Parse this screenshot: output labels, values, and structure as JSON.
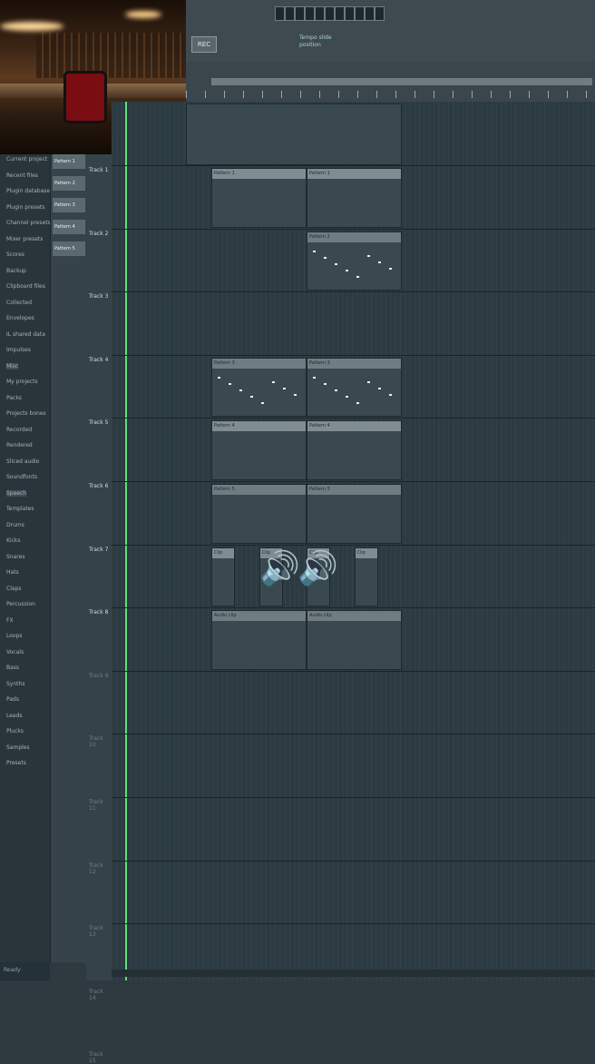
{
  "app": {
    "accent_color": "#5fe07a",
    "clip_header_color": "#7f8c91"
  },
  "toolbar": {
    "transport_label": "REC",
    "hint": "Tempo slide position",
    "icons": [
      "play-icon",
      "stop-icon",
      "record-icon",
      "pattern-icon",
      "song-icon",
      "snap-icon",
      "magnet-icon",
      "metronome-icon",
      "wait-icon",
      "countdown-icon",
      "loop-icon"
    ]
  },
  "browser": {
    "items": [
      "Current project",
      "Recent files",
      "Plugin database",
      "Plugin presets",
      "Channel presets",
      "Mixer presets",
      "Scores",
      "Backup",
      "Clipboard files",
      "Collected",
      "Envelopes",
      "IL shared data",
      "Impulses",
      "Misc",
      "My projects",
      "Packs",
      "Projects bones",
      "Recorded",
      "Rendered",
      "Sliced audio",
      "Soundfonts",
      "Speech",
      "Templates",
      "Drums",
      "Kicks",
      "Snares",
      "Hats",
      "Claps",
      "Percussion",
      "FX",
      "Loops",
      "Vocals",
      "Bass",
      "Synths",
      "Pads",
      "Leads",
      "Plucks",
      "Samples",
      "Presets"
    ]
  },
  "patterns": {
    "items": [
      "Pattern 1",
      "Pattern 2",
      "Pattern 3",
      "Pattern 4",
      "Pattern 5"
    ]
  },
  "tracks": {
    "labels": [
      "Track 1",
      "Track 2",
      "Track 3",
      "Track 4",
      "Track 5",
      "Track 6",
      "Track 7",
      "Track 8",
      "Track 9",
      "Track 10",
      "Track 11",
      "Track 12",
      "Track 13",
      "Track 14",
      "Track 15"
    ]
  },
  "clips": [
    {
      "row": 0,
      "start": 0,
      "len": 1,
      "title": "Pattern 1"
    },
    {
      "row": 0,
      "start": 1,
      "len": 1,
      "title": "Pattern 1"
    },
    {
      "row": 1,
      "start": 1,
      "len": 1,
      "title": "Pattern 2"
    },
    {
      "row": 3,
      "start": 0,
      "len": 1,
      "title": "Pattern 3"
    },
    {
      "row": 3,
      "start": 1,
      "len": 1,
      "title": "Pattern 3"
    },
    {
      "row": 4,
      "start": 0,
      "len": 1,
      "title": "Pattern 4"
    },
    {
      "row": 4,
      "start": 1,
      "len": 1,
      "title": "Pattern 4"
    },
    {
      "row": 5,
      "start": 0,
      "len": 1,
      "title": "Pattern 5"
    },
    {
      "row": 5,
      "start": 1,
      "len": 1,
      "title": "Pattern 5"
    },
    {
      "row": 6,
      "start": 0,
      "len": 0.25,
      "title": "Clip"
    },
    {
      "row": 6,
      "start": 0.5,
      "len": 0.25,
      "title": "Clip"
    },
    {
      "row": 6,
      "start": 1,
      "len": 0.25,
      "title": "Clip"
    },
    {
      "row": 6,
      "start": 1.5,
      "len": 0.25,
      "title": "Clip"
    },
    {
      "row": 7,
      "start": 0,
      "len": 1,
      "title": "Audio clip"
    },
    {
      "row": 7,
      "start": 1,
      "len": 1,
      "title": "Audio clip"
    }
  ],
  "status": {
    "text": "Ready"
  }
}
